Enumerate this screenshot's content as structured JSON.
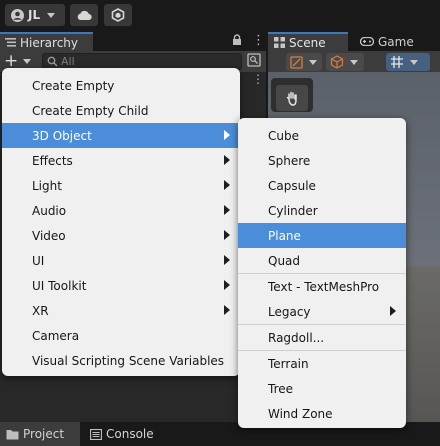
{
  "toolbar": {
    "account_label": "JL",
    "cloud_icon": "cloud-icon",
    "collab_icon": "collab-hexagon-icon"
  },
  "hierarchy": {
    "tab_label": "Hierarchy",
    "search_placeholder": "All"
  },
  "scene": {
    "tab_scene_label": "Scene",
    "tab_game_label": "Game"
  },
  "bottom": {
    "tab_project_label": "Project",
    "tab_console_label": "Console"
  },
  "create_menu": {
    "items": [
      {
        "label": "Create Empty"
      },
      {
        "label": "Create Empty Child"
      },
      {
        "label": "3D Object"
      },
      {
        "label": "Effects"
      },
      {
        "label": "Light"
      },
      {
        "label": "Audio"
      },
      {
        "label": "Video"
      },
      {
        "label": "UI"
      },
      {
        "label": "UI Toolkit"
      },
      {
        "label": "XR"
      },
      {
        "label": "Camera"
      },
      {
        "label": "Visual Scripting Scene Variables"
      }
    ]
  },
  "object_menu": {
    "items": [
      {
        "label": "Cube"
      },
      {
        "label": "Sphere"
      },
      {
        "label": "Capsule"
      },
      {
        "label": "Cylinder"
      },
      {
        "label": "Plane"
      },
      {
        "label": "Quad"
      },
      {
        "label": "Text - TextMeshPro"
      },
      {
        "label": "Legacy"
      },
      {
        "label": "Ragdoll..."
      },
      {
        "label": "Terrain"
      },
      {
        "label": "Tree"
      },
      {
        "label": "Wind Zone"
      }
    ]
  },
  "colors": {
    "accent": "#3a79bb",
    "menu_highlight": "#4b8dd9",
    "menu_background": "#f0f0f0"
  }
}
